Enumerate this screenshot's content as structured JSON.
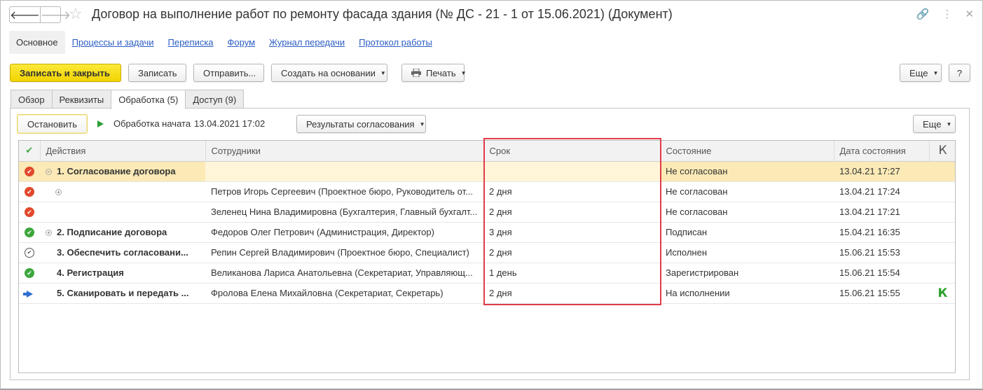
{
  "window": {
    "title": "Договор  на  выполнение работ по ремонту фасада здания (№ ДС - 21 - 1 от 15.06.2021) (Документ)",
    "back_glyph": "🡐",
    "forward_glyph": "🡒",
    "star_glyph": "☆",
    "link_glyph": "🔗",
    "menu_glyph": "⋮",
    "close_glyph": "✕"
  },
  "form_tabs": [
    "Основное",
    "Процессы и задачи",
    "Переписка",
    "Форум",
    "Журнал передачи",
    "Протокол работы"
  ],
  "toolbar": {
    "save_close": "Записать и закрыть",
    "save": "Записать",
    "send": "Отправить...",
    "create_based": "Создать на основании",
    "print": "Печать",
    "more": "Еще",
    "help": "?"
  },
  "inner_tabs": [
    "Обзор",
    "Реквизиты",
    "Обработка (5)",
    "Доступ (9)"
  ],
  "processing": {
    "stop": "Остановить",
    "started_label": "Обработка начата",
    "started_date": "13.04.2021 17:02",
    "results": "Результаты согласования",
    "more": "Еще"
  },
  "grid": {
    "columns": {
      "check": "✔",
      "actions": "Действия",
      "employees": "Сотрудники",
      "term": "Срок",
      "state": "Состояние",
      "state_date": "Дата состояния",
      "k": "К"
    },
    "rows": [
      {
        "status": "red",
        "tree": "⊖",
        "action": "1. Согласование договора",
        "employee": "",
        "term": "",
        "state": "Не согласован",
        "date": "13.04.21 17:27",
        "k": ""
      },
      {
        "status": "red",
        "tree": "⊕",
        "action": "",
        "employee": "Петров Игорь Сергеевич (Проектное бюро, Руководитель от...",
        "term": "2 дня",
        "state": "Не согласован",
        "date": "13.04.21 17:24",
        "k": ""
      },
      {
        "status": "red",
        "tree": "",
        "action": "",
        "employee": "Зеленец Нина Владимировна (Бухгалтерия, Главный бухгалт...",
        "term": "2 дня",
        "state": "Не согласован",
        "date": "13.04.21 17:21",
        "k": ""
      },
      {
        "status": "green",
        "tree": "⊕",
        "action": "2. Подписание договора",
        "employee": "Федоров Олег Петрович (Администрация, Директор)",
        "term": "3 дня",
        "state": "Подписан",
        "date": "15.04.21 16:35",
        "k": ""
      },
      {
        "status": "done",
        "tree": "",
        "action": "3. Обеспечить согласовани...",
        "employee": "Репин Сергей Владимирович (Проектное бюро, Специалист)",
        "term": "2 дня",
        "state": "Исполнен",
        "date": "15.06.21 15:53",
        "k": ""
      },
      {
        "status": "green",
        "tree": "",
        "action": "4. Регистрация",
        "employee": "Великанова Лариса Анатольевна (Секретариат, Управляющ...",
        "term": "1 день",
        "state": "Зарегистрирован",
        "date": "15.06.21 15:54",
        "k": ""
      },
      {
        "status": "arrow",
        "tree": "",
        "action": "5. Сканировать и передать ...",
        "employee": "Фролова Елена Михайловна (Секретариат, Секретарь)",
        "term": "2 дня",
        "state": "На исполнении",
        "date": "15.06.21 15:55",
        "k": "К"
      }
    ]
  },
  "colors": {
    "accent_yellow": "#f2d400",
    "selected_row": "#fbeab6",
    "highlight_border": "#e03c4a",
    "link": "#2c5ec4"
  }
}
